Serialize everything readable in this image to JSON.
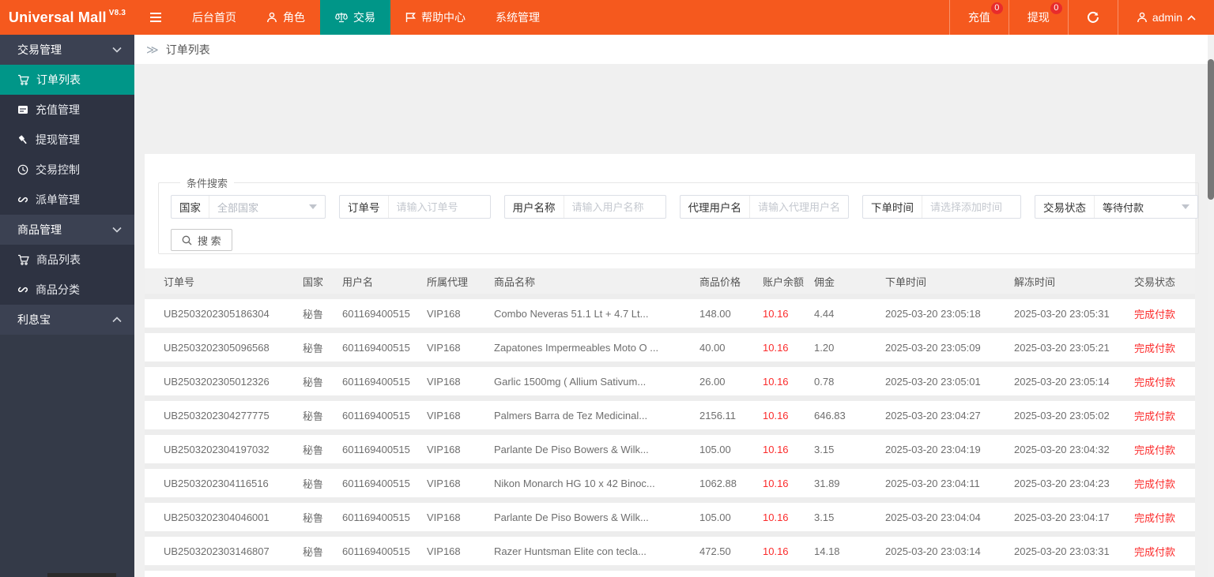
{
  "brand": {
    "name": "Universal Mall",
    "version": "V8.3"
  },
  "topnav": {
    "items": [
      {
        "label": "后台首页",
        "icon": null,
        "active": false
      },
      {
        "label": "角色",
        "icon": "person-icon",
        "active": false
      },
      {
        "label": "交易",
        "icon": "scales-icon",
        "active": true
      },
      {
        "label": "帮助中心",
        "icon": "flag-icon",
        "active": false
      },
      {
        "label": "系统管理",
        "icon": null,
        "active": false
      }
    ],
    "right": {
      "recharge": {
        "label": "充值",
        "badge": "0"
      },
      "withdraw": {
        "label": "提现",
        "badge": "0"
      },
      "user": {
        "label": "admin"
      }
    }
  },
  "sidebar": {
    "groups": [
      {
        "label": "交易管理",
        "expanded": true,
        "items": [
          {
            "label": "订单列表",
            "icon": "cart-icon",
            "active": true
          },
          {
            "label": "充值管理",
            "icon": "card-icon",
            "active": false
          },
          {
            "label": "提现管理",
            "icon": "gavel-icon",
            "active": false
          },
          {
            "label": "交易控制",
            "icon": "clock-icon",
            "active": false
          },
          {
            "label": "派单管理",
            "icon": "link-icon",
            "active": false
          }
        ]
      },
      {
        "label": "商品管理",
        "expanded": true,
        "items": [
          {
            "label": "商品列表",
            "icon": "cart-icon",
            "active": false
          },
          {
            "label": "商品分类",
            "icon": "link-icon",
            "active": false
          }
        ]
      },
      {
        "label": "利息宝",
        "expanded": false,
        "items": []
      }
    ]
  },
  "breadcrumb": {
    "icon": "≫",
    "label": "订单列表"
  },
  "search": {
    "legend": "条件搜索",
    "fields": [
      {
        "label": "国家",
        "type": "select",
        "value": "全部国家",
        "value_is_placeholder": true
      },
      {
        "label": "订单号",
        "type": "input",
        "placeholder": "请输入订单号"
      },
      {
        "label": "用户名称",
        "type": "input",
        "placeholder": "请输入用户名称"
      },
      {
        "label": "代理用户名",
        "type": "input",
        "placeholder": "请输入代理用户名"
      },
      {
        "label": "下单时间",
        "type": "input",
        "placeholder": "请选择添加时间"
      },
      {
        "label": "交易状态",
        "type": "select",
        "value": "等待付款",
        "value_is_placeholder": false
      }
    ],
    "button_label": "搜 索"
  },
  "table": {
    "columns": [
      "订单号",
      "国家",
      "用户名",
      "所属代理",
      "商品名称",
      "商品价格",
      "账户余额",
      "佣金",
      "下单时间",
      "解冻时间",
      "交易状态"
    ],
    "rows": [
      [
        "UB2503202305186304",
        "秘鲁",
        "601169400515",
        "VIP168",
        "Combo Neveras 51.1 Lt + 4.7 Lt...",
        "148.00",
        "10.16",
        "4.44",
        "2025-03-20 23:05:18",
        "2025-03-20 23:05:31",
        "完成付款"
      ],
      [
        "UB2503202305096568",
        "秘鲁",
        "601169400515",
        "VIP168",
        "Zapatones Impermeables Moto O ...",
        "40.00",
        "10.16",
        "1.20",
        "2025-03-20 23:05:09",
        "2025-03-20 23:05:21",
        "完成付款"
      ],
      [
        "UB2503202305012326",
        "秘鲁",
        "601169400515",
        "VIP168",
        "Garlic 1500mg ( Allium Sativum...",
        "26.00",
        "10.16",
        "0.78",
        "2025-03-20 23:05:01",
        "2025-03-20 23:05:14",
        "完成付款"
      ],
      [
        "UB2503202304277775",
        "秘鲁",
        "601169400515",
        "VIP168",
        "Palmers Barra de Tez Medicinal...",
        "2156.11",
        "10.16",
        "646.83",
        "2025-03-20 23:04:27",
        "2025-03-20 23:05:02",
        "完成付款"
      ],
      [
        "UB2503202304197032",
        "秘鲁",
        "601169400515",
        "VIP168",
        "Parlante De Piso Bowers & Wilk...",
        "105.00",
        "10.16",
        "3.15",
        "2025-03-20 23:04:19",
        "2025-03-20 23:04:32",
        "完成付款"
      ],
      [
        "UB2503202304116516",
        "秘鲁",
        "601169400515",
        "VIP168",
        "Nikon Monarch HG 10 x 42 Binoc...",
        "1062.88",
        "10.16",
        "31.89",
        "2025-03-20 23:04:11",
        "2025-03-20 23:04:23",
        "完成付款"
      ],
      [
        "UB2503202304046001",
        "秘鲁",
        "601169400515",
        "VIP168",
        "Parlante De Piso Bowers & Wilk...",
        "105.00",
        "10.16",
        "3.15",
        "2025-03-20 23:04:04",
        "2025-03-20 23:04:17",
        "完成付款"
      ],
      [
        "UB2503202303146807",
        "秘鲁",
        "601169400515",
        "VIP168",
        "Razer Huntsman Elite con tecla...",
        "472.50",
        "10.16",
        "14.18",
        "2025-03-20 23:03:14",
        "2025-03-20 23:03:31",
        "完成付款"
      ]
    ]
  },
  "colors": {
    "topbar_orange": "#f5591e",
    "active_teal": "#009688",
    "danger_red": "#fb2b2b",
    "sidebar_dark": "#343a48"
  }
}
